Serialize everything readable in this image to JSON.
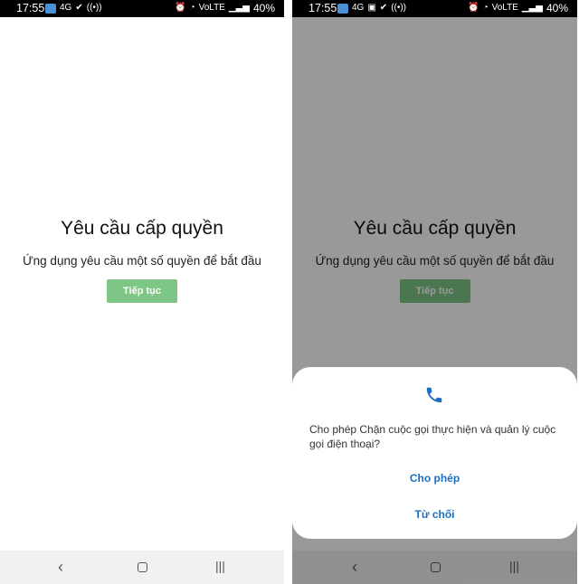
{
  "statusbar": {
    "time": "17:55",
    "battery": "40%",
    "left_icons": [
      "notification-badge",
      "4g-icon",
      "check-icon",
      "signal-icon"
    ],
    "right_icons": [
      "alarm-icon",
      "wifi-icon",
      "volte-icon",
      "signal-bars-icon"
    ]
  },
  "screen": {
    "title": "Yêu cầu cấp quyền",
    "subtitle": "Ứng dụng yêu cầu một số quyền để bắt đầu",
    "continue_label": "Tiếp tục"
  },
  "dialog": {
    "icon": "phone-icon",
    "message": "Cho phép Chặn cuộc gọi thực hiện và quản lý cuộc gọi điện thoại?",
    "allow_label": "Cho phép",
    "deny_label": "Từ chối"
  },
  "navbar": {
    "back_icon": "back-icon",
    "home_icon": "home-icon",
    "recents_icon": "recents-icon"
  },
  "colors": {
    "accent_green": "#7ec685",
    "dialog_button_blue": "#1a6fbf",
    "statusbar": "#000000",
    "navbar": "#f1f1f1"
  }
}
